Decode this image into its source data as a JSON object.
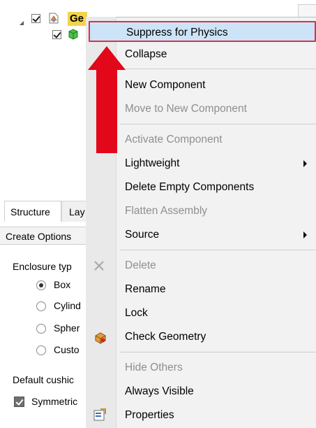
{
  "tree": {
    "root_label": "Ge",
    "root_checked": true,
    "child_checked": true
  },
  "panel": {
    "tabs": [
      "Structure",
      "Lay"
    ],
    "title": "Create Options",
    "enclosure_label": "Enclosure typ",
    "enclosure_options": [
      {
        "label": "Box",
        "selected": true
      },
      {
        "label": "Cylind",
        "selected": false
      },
      {
        "label": "Spher",
        "selected": false
      },
      {
        "label": "Custo",
        "selected": false
      }
    ],
    "cushion_label": "Default cushic",
    "symmetric_label": "Symmetric",
    "symmetric_checked": true
  },
  "context_menu": {
    "items": [
      {
        "label": "Suppress for Physics",
        "enabled": true,
        "highlighted": true
      },
      {
        "label": "Collapse",
        "enabled": true
      },
      {
        "label": "New Component",
        "enabled": true
      },
      {
        "label": "Move to New Component",
        "enabled": false
      },
      {
        "label": "Activate Component",
        "enabled": false
      },
      {
        "label": "Lightweight",
        "enabled": true,
        "submenu": true
      },
      {
        "label": "Delete Empty Components",
        "enabled": true
      },
      {
        "label": "Flatten Assembly",
        "enabled": false
      },
      {
        "label": "Source",
        "enabled": true,
        "submenu": true
      },
      {
        "label": "Delete",
        "enabled": false,
        "icon": "delete-x-icon"
      },
      {
        "label": "Rename",
        "enabled": true
      },
      {
        "label": "Lock",
        "enabled": true
      },
      {
        "label": "Check Geometry",
        "enabled": true,
        "icon": "check-geometry-icon"
      },
      {
        "label": "Hide Others",
        "enabled": false
      },
      {
        "label": "Always Visible",
        "enabled": true
      },
      {
        "label": "Properties",
        "enabled": true,
        "icon": "properties-icon"
      }
    ]
  },
  "annotation": {
    "arrow": "red-up-arrow",
    "color": "#e3071a"
  },
  "colors": {
    "highlight_bg": "#cde3f7",
    "highlight_border": "#d9324a",
    "selected_tree_bg": "#f3d34a",
    "disabled_text": "#8f8f8f"
  }
}
